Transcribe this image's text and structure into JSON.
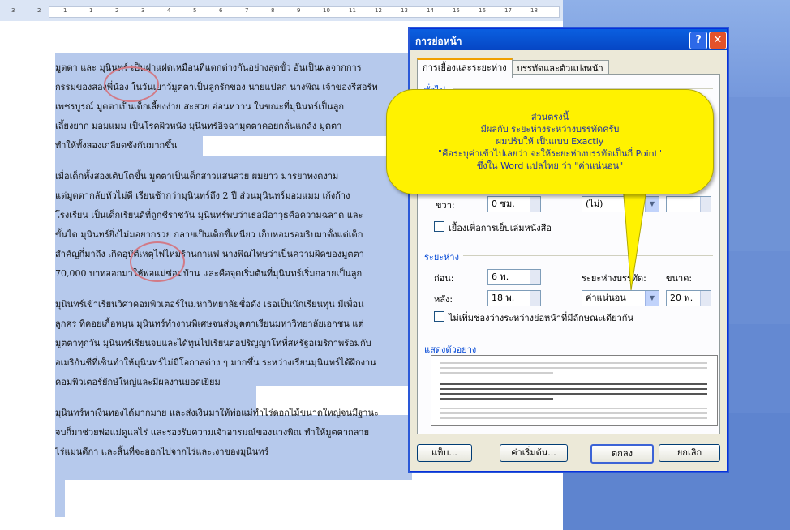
{
  "ruler": {
    "ticks": [
      "3",
      "2",
      "1",
      "1",
      "2",
      "3",
      "4",
      "5",
      "6",
      "7",
      "8",
      "9",
      "10",
      "11",
      "12",
      "13",
      "14",
      "15",
      "16",
      "17",
      "18"
    ]
  },
  "document": {
    "lines": [
      "มูตตา และ มุนินทร์ เป็นฝาแฝดเหมือนที่แตกต่างกันอย่างสุดขั้ว อันเป็นผลจากการ",
      "กรรมของสองพี่น้อง ในวันเยาว์มูตตาเป็นลูกรักของ นายแปลก นางพิณ เจ้าของรีสอร์ท",
      "เพชรบูรณ์ มูตตาเป็นเด็กเลี้ยงง่าย สะสวย อ่อนหวาน ในขณะที่มุนินทร์เป็นลูก",
      "เลี้ยงยาก มอมแมม เป็นโรคผิวหนัง มุนินทร์อิจฉามูตตาคอยกลั่นแกล้ง มูตตา",
      "ทำให้ทั้งสองเกลียดชังกันมากขึ้น",
      "",
      "เมื่อเด็กทั้งสองเติบโตขึ้น มูตตาเป็นเด็กสาวแสนสวย ผมยาว มารยาทงดงาม",
      "แต่มูตตากลับหัวไม่ดี เรียนช้ากว่ามุนินทร์ถึง 2 ปี ส่วนมุนินทร์มอมแมม เก้งก้าง",
      "โรงเรียน เป็นเด็กเรียนดีที่ถูกชีราชวัน มุนินทร์พบว่าเธอมีอาวุธคือความฉลาด และ",
      "ขั้นได มุนินทร์ยิ่งไม่มอยากรวย กลายเป็นเด็กขี้เหนียว เก็บหอมรอมริบมาตั้งแต่เด็ก",
      "สำคัญกี่มาถึง เกิดอุบัติเหตุไฟไหม้ร้านกาแฟ นางพิณไทษว่าเป็นความผิดของมูตตา",
      "70,000 บาทออกมาให้พ่อแม่ซ่อมบ้าน และคือจุดเริ่มต้นที่มุนินทร์เริ่มกลายเป็นลูก",
      "",
      "มุนินทร์เข้าเรียนวิศวคอมพิวเตอร์ในมหาวิทยาลัยชื่อดัง เธอเป็นนักเรียนทุน มีเพื่อน",
      "ลูกศร ที่คอยเกื้อหนุน มุนินทร์ทำงานพิเศษจนส่งมูตตาเรียนมหาวิทยาลัยเอกชน แต่",
      "มูตตาทุกวัน มุนินทร์เรียนจบและได้ทุนไปเรียนต่อปริญญาโทที่สหรัฐอเมริกาพร้อมกับ",
      "อเมริกันซีที่เซ็นทำให้มุนินทร์ไม่มีโอกาสต่าง ๆ มากขึ้น ระหว่างเรียนมุนินทร์ได้ฝึกงาน",
      "คอมพิวเตอร์ยักษ์ใหญ่และมีผลงานยอดเยี่ยม",
      "",
      "มุนินทร์หาเงินทองได้มากมาย และส่งเงินมาให้พ่อแม่ทำไร่ดอกไม้ขนาดใหญ่จนมีฐานะ",
      "จบก็มาช่วยพ่อแม่ดูแลไร่ และรองรับความเจ้าอารมณ์ของนางพิณ ทำให้มูตตากลาย",
      "ไร่แมนดีกา และสิ้นที่จะออกไปจากไร่และเงาของมุนินทร์"
    ]
  },
  "dialog": {
    "title": "การย่อหน้า",
    "help_glyph": "?",
    "close_glyph": "✕",
    "tabs": [
      "การเยื้องและระยะห่าง",
      "บรรทัดและตัวแบ่งหน้า"
    ],
    "general_group": "ทั่วไป",
    "indent": {
      "right_label": "ขวา:",
      "right_value": "0 ซม.",
      "special_value": "(ไม่)",
      "mirror_label": "เยื้องเพื่อการเย็บเล่มหนังสือ"
    },
    "spacing": {
      "group": "ระยะห่าง",
      "before_label": "ก่อน:",
      "before_value": "6 พ.",
      "after_label": "หลัง:",
      "after_value": "18 พ.",
      "line_spacing_label": "ระยะห่างบรรทัด:",
      "line_spacing_value": "ค่าแน่นอน",
      "at_label": "ขนาด:",
      "at_value": "20 พ.",
      "dont_add_label": "ไม่เพิ่มช่องว่างระหว่างย่อหน้าที่มีลักษณะเดียวกัน"
    },
    "preview_label": "แสดงตัวอย่าง",
    "buttons": {
      "tabs": "แท็บ...",
      "default": "ค่าเริ่มต้น...",
      "ok": "ตกลง",
      "cancel": "ยกเลิก"
    }
  },
  "callout": {
    "lines": [
      "ส่วนตรงนี้",
      "มีผลกับ ระยะห่างระหว่างบรรทัดครับ",
      "ผมปรับให้ เป็นแบบ Exactly",
      "\"คือระบุค่าเข้าไปเลยว่า จะให้ระยะห่างบรรทัดเป็นกี่ Point\"",
      "ซึ่งใน Word แปลไทย ว่า \"ค่าแน่นอน\""
    ]
  },
  "colors": {
    "selection": "#b6c9ec",
    "callout_fill": "#fff200",
    "callout_text": "#1d2fa8",
    "title_bar": "#0a5fe0",
    "annotation_circle": "#d27a86"
  }
}
